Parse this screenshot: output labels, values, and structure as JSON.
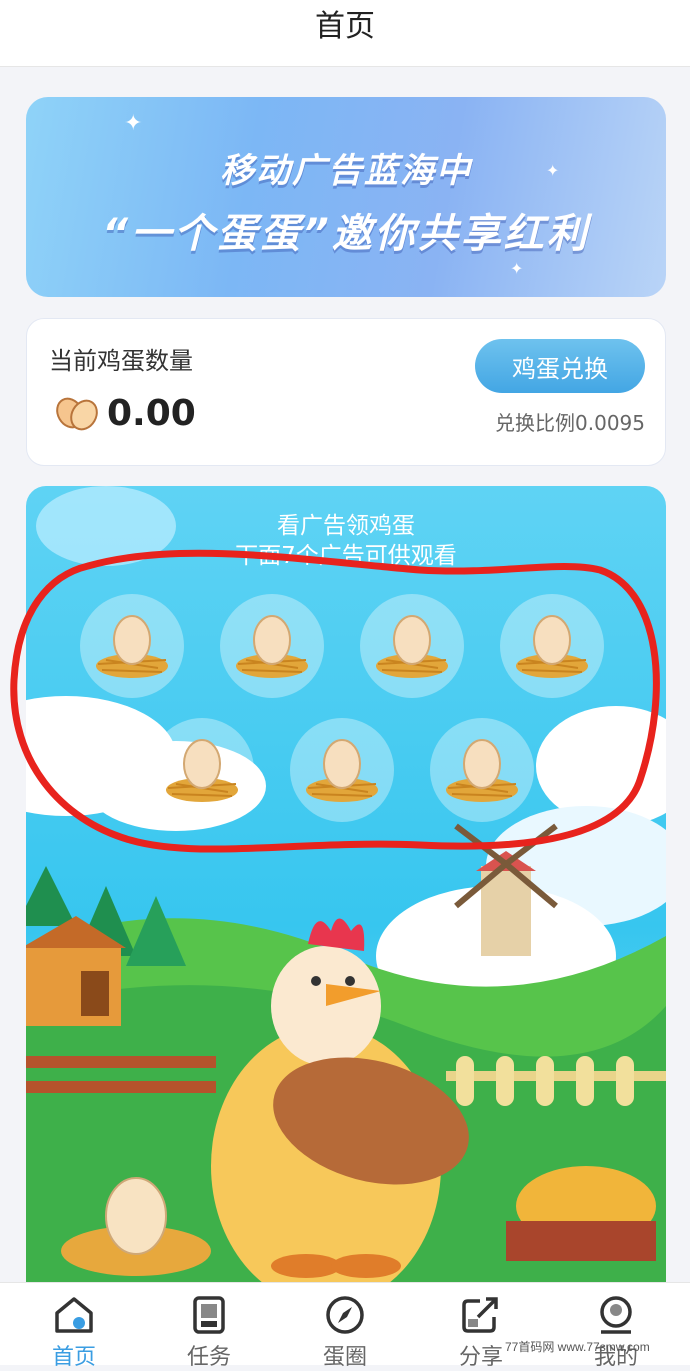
{
  "header": {
    "title": "首页"
  },
  "banner": {
    "line1": "移动广告蓝海中",
    "line2": "“一个蛋蛋”邀你共享红利"
  },
  "egg_card": {
    "label": "当前鸡蛋数量",
    "value": "0.00",
    "exchange_button": "鸡蛋兑换",
    "ratio_text": "兑换比例0.0095",
    "icon": "eggs-icon"
  },
  "ad_section": {
    "hint_line1": "看广告领鸡蛋",
    "hint_line2": "下面7个广告可供观看",
    "egg_count": 7
  },
  "tabbar": {
    "tabs": [
      {
        "label": "首页",
        "icon": "home-icon",
        "active": true
      },
      {
        "label": "任务",
        "icon": "task-icon",
        "active": false
      },
      {
        "label": "蛋圈",
        "icon": "compass-icon",
        "active": false
      },
      {
        "label": "分享",
        "icon": "share-icon",
        "active": false
      },
      {
        "label": "我的",
        "icon": "profile-icon",
        "active": false
      }
    ]
  },
  "watermark": "77首码网 www.77smw.com",
  "colors": {
    "accent": "#3a9de2",
    "sky": "#37c6ef",
    "annotation": "#e8231d"
  }
}
